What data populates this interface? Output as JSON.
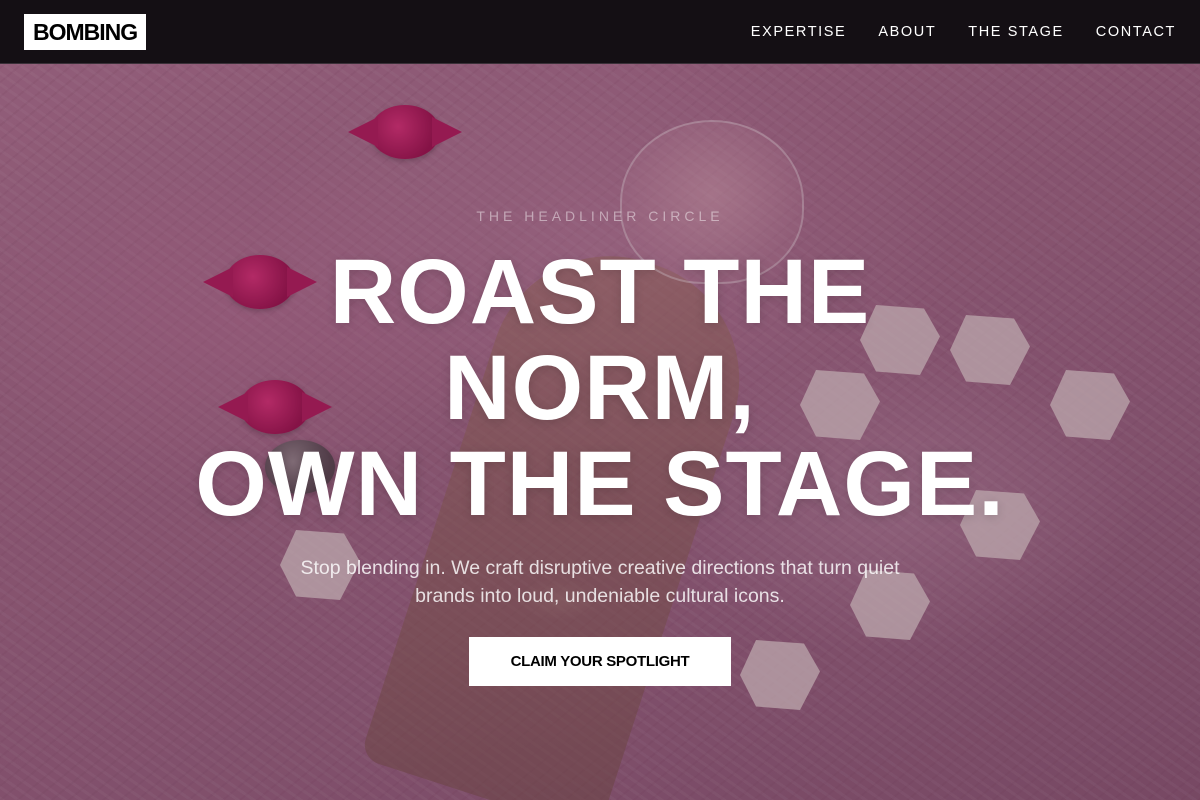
{
  "header": {
    "logo": "BOMBING",
    "nav": [
      {
        "label": "EXPERTISE"
      },
      {
        "label": "ABOUT"
      },
      {
        "label": "THE STAGE"
      },
      {
        "label": "CONTACT"
      }
    ]
  },
  "hero": {
    "eyebrow": "THE HEADLINER CIRCLE",
    "headline_lines": [
      "ROAST THE",
      "NORM,",
      "OWN THE STAGE."
    ],
    "subtext": "Stop blending in. We craft disruptive creative directions that turn quiet brands into loud, undeniable cultural icons.",
    "cta_label": "CLAIM YOUR SPOTLIGHT"
  },
  "colors": {
    "header_bg": "#140f14",
    "hero_tint": "#a56a88",
    "text": "#ffffff",
    "cta_bg": "#ffffff",
    "cta_text": "#000000"
  }
}
